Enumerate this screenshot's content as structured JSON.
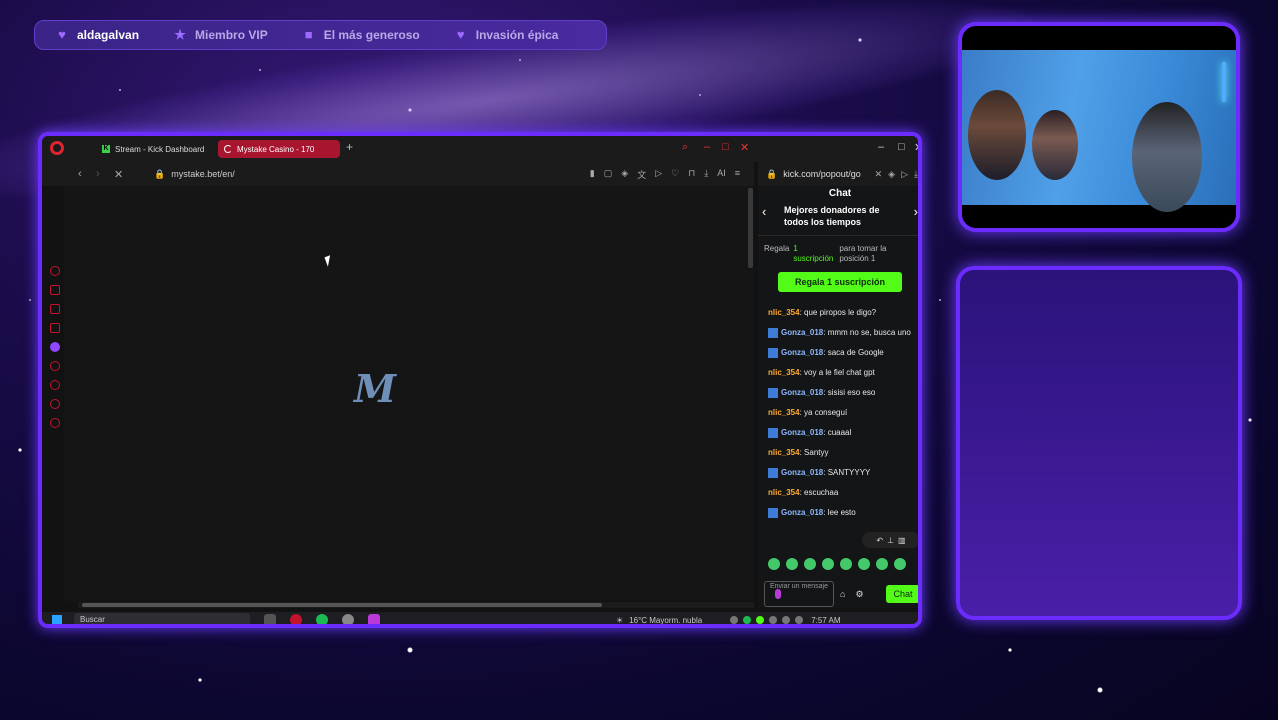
{
  "overlay": {
    "badges": [
      {
        "icon": "heart-icon",
        "label": "aldagalvan"
      },
      {
        "icon": "star-icon",
        "label": "Miembro VIP"
      },
      {
        "icon": "gift-icon",
        "label": "El más generoso"
      },
      {
        "icon": "heart-icon",
        "label": "Invasión épica"
      }
    ]
  },
  "browser": {
    "tabs": [
      {
        "label": "Stream - Kick Dashboard"
      },
      {
        "label": "Mystake Casino - 170"
      }
    ],
    "address": "mystake.bet/en/",
    "ai_label": "AI",
    "page_logo": "M"
  },
  "chat": {
    "url": "kick.com/popout/go",
    "title": "Chat",
    "top_donors": "Mejores donadores de todos los tiempos",
    "gift_prefix": "Regala",
    "gift_count": "1",
    "gift_unit": "suscripción",
    "gift_suffix": "para tomar la posición 1",
    "gift_button": "Regala 1 suscripción",
    "messages": [
      {
        "user": "nlic_354",
        "text": "que piropos le digo?",
        "type": "u2"
      },
      {
        "user": "Gonza_018",
        "text": "mmm no se, busca uno",
        "type": "u1"
      },
      {
        "user": "Gonza_018",
        "text": "saca de Google",
        "type": "u1"
      },
      {
        "user": "nlic_354",
        "text": "voy a le fiel chat gpt",
        "type": "u2"
      },
      {
        "user": "Gonza_018",
        "text": "sisisi eso eso",
        "type": "u1"
      },
      {
        "user": "nlic_354",
        "text": "ya conseguí",
        "type": "u2"
      },
      {
        "user": "Gonza_018",
        "text": "cuaaal",
        "type": "u1"
      },
      {
        "user": "nlic_354",
        "text": "Santyy",
        "type": "u2"
      },
      {
        "user": "Gonza_018",
        "text": "SANTYYYY",
        "type": "u1"
      },
      {
        "user": "nlic_354",
        "text": "escuchaa",
        "type": "u2"
      },
      {
        "user": "Gonza_018",
        "text": "lee esto",
        "type": "u1"
      }
    ],
    "input_placeholder": "Enviar un mensaje",
    "send_button": "Chat"
  },
  "taskbar": {
    "search": "Buscar",
    "weather": "16°C  Mayorm. nubla",
    "clock": "7:57 AM"
  },
  "colors": {
    "frame": "#6d2cff",
    "kick_green": "#53fc18",
    "opera_red": "#e0242d"
  }
}
